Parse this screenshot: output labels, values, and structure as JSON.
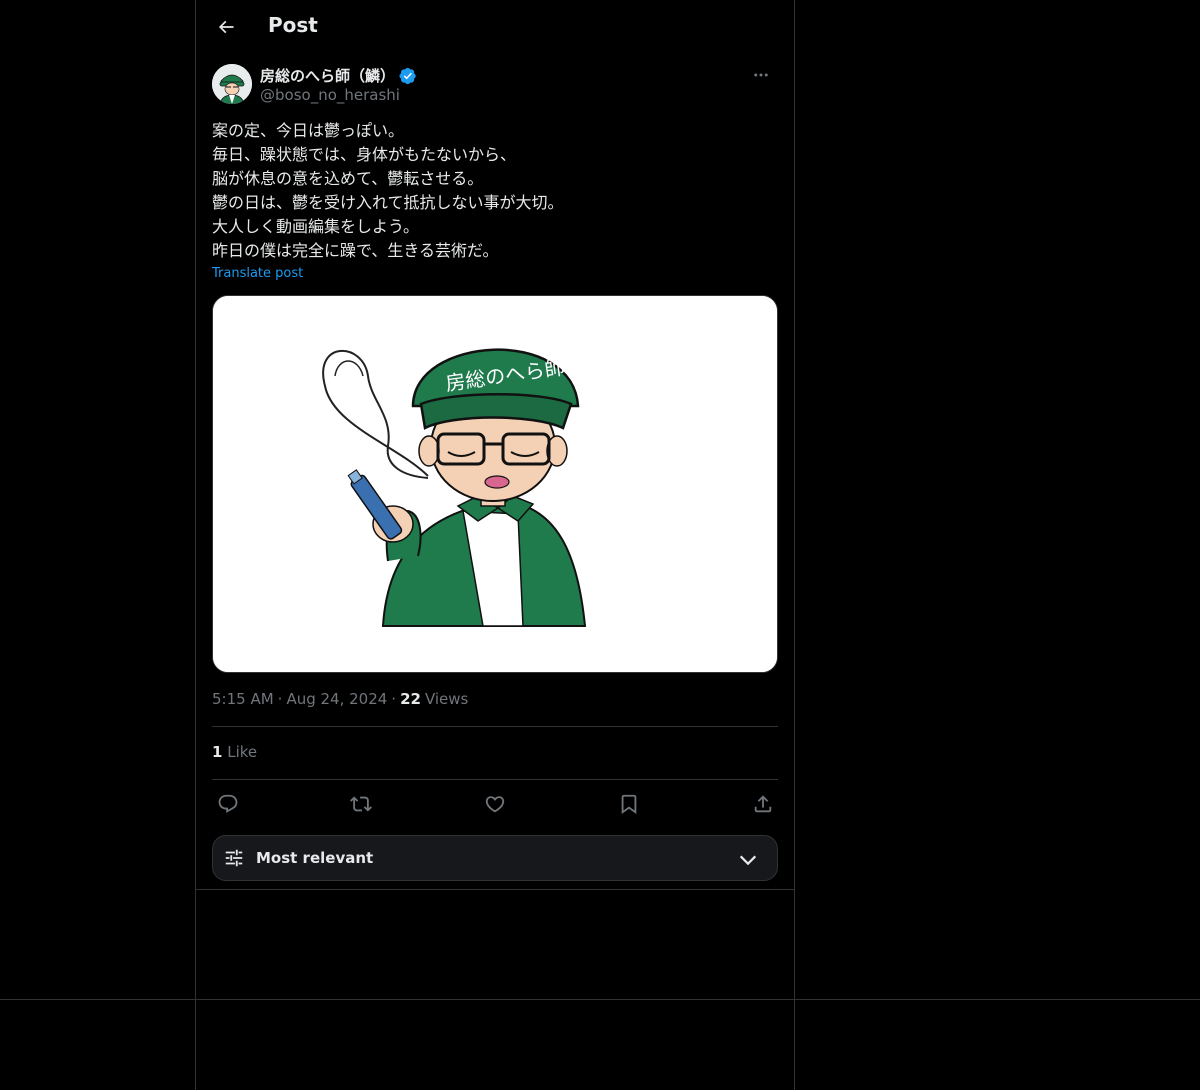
{
  "header": {
    "title": "Post",
    "back_icon": "arrow-left-icon"
  },
  "author": {
    "display_name": "房総のへら師（鱗）",
    "handle": "@boso_no_herashi",
    "verified_color": "#1d9bf0"
  },
  "post": {
    "text": "案の定、今日は鬱っぽい。\n毎日、躁状態では、身体がもたないから、\n脳が休息の意を込めて、鬱転させる。\n鬱の日は、鬱を受け入れて抵抗しない事が大切。\n大人しく動画編集をしよう。\n昨日の僕は完全に躁で、生きる芸術だ。",
    "translate_label": "Translate post",
    "image_cap_text": "房総のへら師"
  },
  "meta": {
    "time": "5:15 AM",
    "separator": "·",
    "date": "Aug 24, 2024",
    "views_count": "22",
    "views_label": "Views"
  },
  "likes": {
    "count": "1",
    "label": "Like"
  },
  "actions": [
    "reply-icon",
    "repost-icon",
    "like-icon",
    "bookmark-icon",
    "share-icon"
  ],
  "sort": {
    "label": "Most relevant"
  },
  "colors": {
    "accent": "#1d9bf0",
    "background": "#000000",
    "border": "#2f3336",
    "muted_text": "#71767b",
    "cap_green": "#1f7a4c"
  }
}
